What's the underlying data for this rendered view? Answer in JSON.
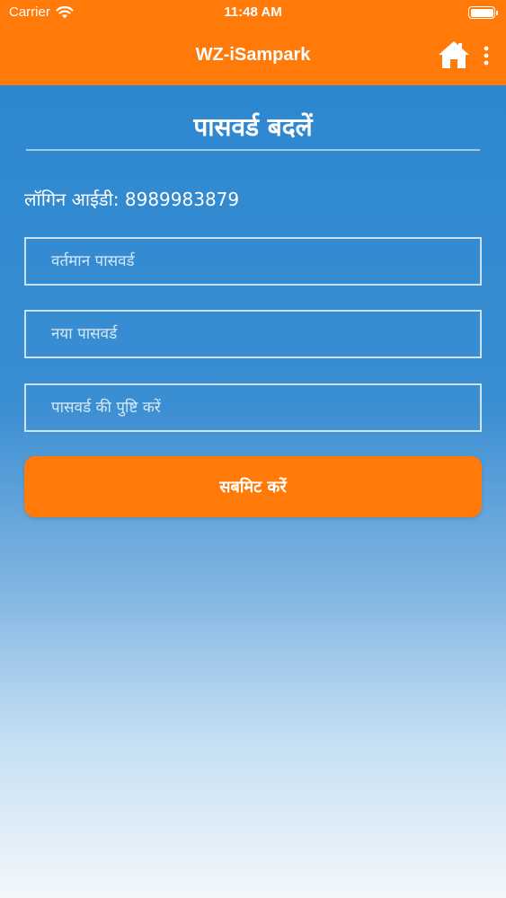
{
  "status_bar": {
    "carrier": "Carrier",
    "time": "11:48 AM",
    "wifi_icon": "wifi-icon",
    "battery_icon": "battery-icon"
  },
  "nav": {
    "title": "WZ-iSampark",
    "home_icon": "home-icon",
    "more_icon": "more-vertical-icon"
  },
  "page": {
    "title": "पासवर्ड बदलें",
    "login_label": "लॉगिन आईडी: 8989983879"
  },
  "form": {
    "current_password": {
      "value": "",
      "placeholder": "वर्तमान पासवर्ड"
    },
    "new_password": {
      "value": "",
      "placeholder": "नया पासवर्ड"
    },
    "confirm_password": {
      "value": "",
      "placeholder": "पासवर्ड की पुष्टि करें"
    },
    "submit_label": "सबमिट करें"
  },
  "colors": {
    "accent": "#ff7a08",
    "background_top": "#2a86cf",
    "background_bottom": "#f3f8fc"
  }
}
